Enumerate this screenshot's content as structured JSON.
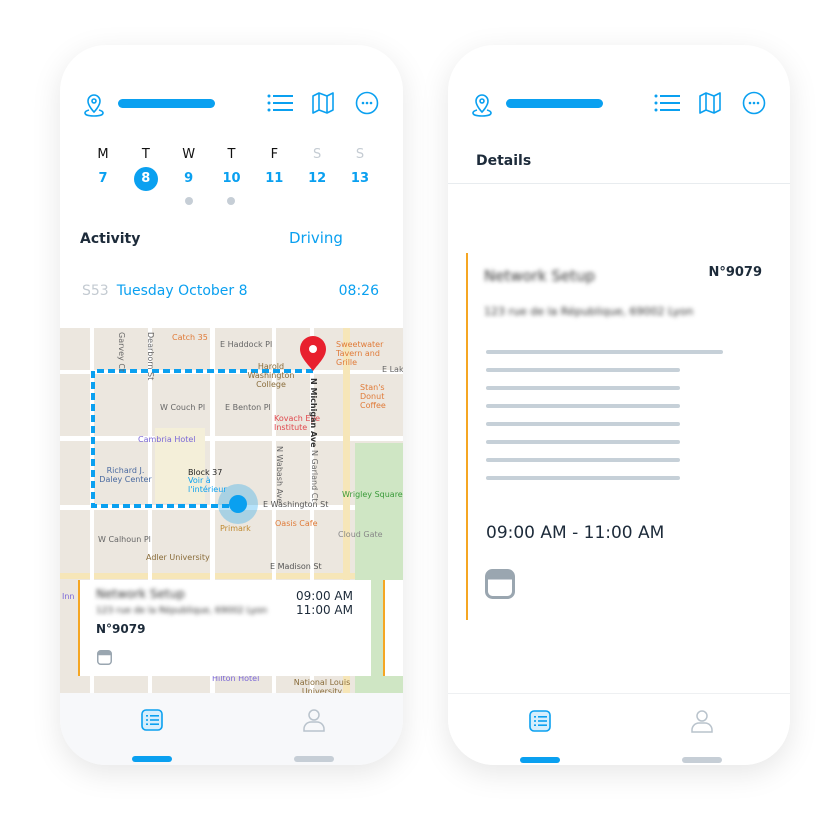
{
  "colors": {
    "accent": "#0aa0f0",
    "card_border": "#f5a623",
    "pin": "#e8202e",
    "muted": "#c6ced6"
  },
  "header": {
    "icons": [
      "location-pin-icon",
      "list-icon",
      "map-icon",
      "more-icon"
    ]
  },
  "week": [
    {
      "l": "M",
      "n": "7"
    },
    {
      "l": "T",
      "n": "8",
      "selected": true
    },
    {
      "l": "W",
      "n": "9",
      "dot": true
    },
    {
      "l": "T",
      "n": "10",
      "dot": true
    },
    {
      "l": "F",
      "n": "11"
    },
    {
      "l": "S",
      "n": "12",
      "weekend": true
    },
    {
      "l": "S",
      "n": "13",
      "weekend": true
    }
  ],
  "activity": {
    "label": "Activity",
    "mode": "Driving"
  },
  "day_row": {
    "week": "S53",
    "date": "Tuesday October 8",
    "time": "08:26"
  },
  "map": {
    "labels": [
      "Catch 35",
      "E Haddock Pl",
      "Harold Washington College",
      "Sweetwater Tavern and Grille",
      "W Couch Pl",
      "E Benton Pl",
      "Kovach Eye Institute",
      "Stan's Donut Coffee",
      "Cambria Hotel",
      "Richard J. Daley Center",
      "Block 37",
      "Voir à l'intérieur",
      "Wrigley Square",
      "E Washington St",
      "Primark",
      "Oasis Cafe",
      "W Calhoun Pl",
      "Adler University",
      "Cloud Gate",
      "E Madison St",
      "N Michigan Ave",
      "Hilton Hotel",
      "National Louis University",
      "Garvey Ct",
      "Dearborn St",
      "N Wabash Ave",
      "N Garland Ct",
      "Inn",
      "E Lake"
    ]
  },
  "job": {
    "title": "Network Setup",
    "address": "123 rue de la République, 69002 Lyon",
    "number": "N°9079",
    "start": "09:00 AM",
    "end": "11:00 AM",
    "range": "09:00 AM - 11:00 AM"
  },
  "details": {
    "title": "Details"
  },
  "tabs": [
    {
      "name": "list",
      "active": true
    },
    {
      "name": "profile",
      "active": false
    }
  ]
}
